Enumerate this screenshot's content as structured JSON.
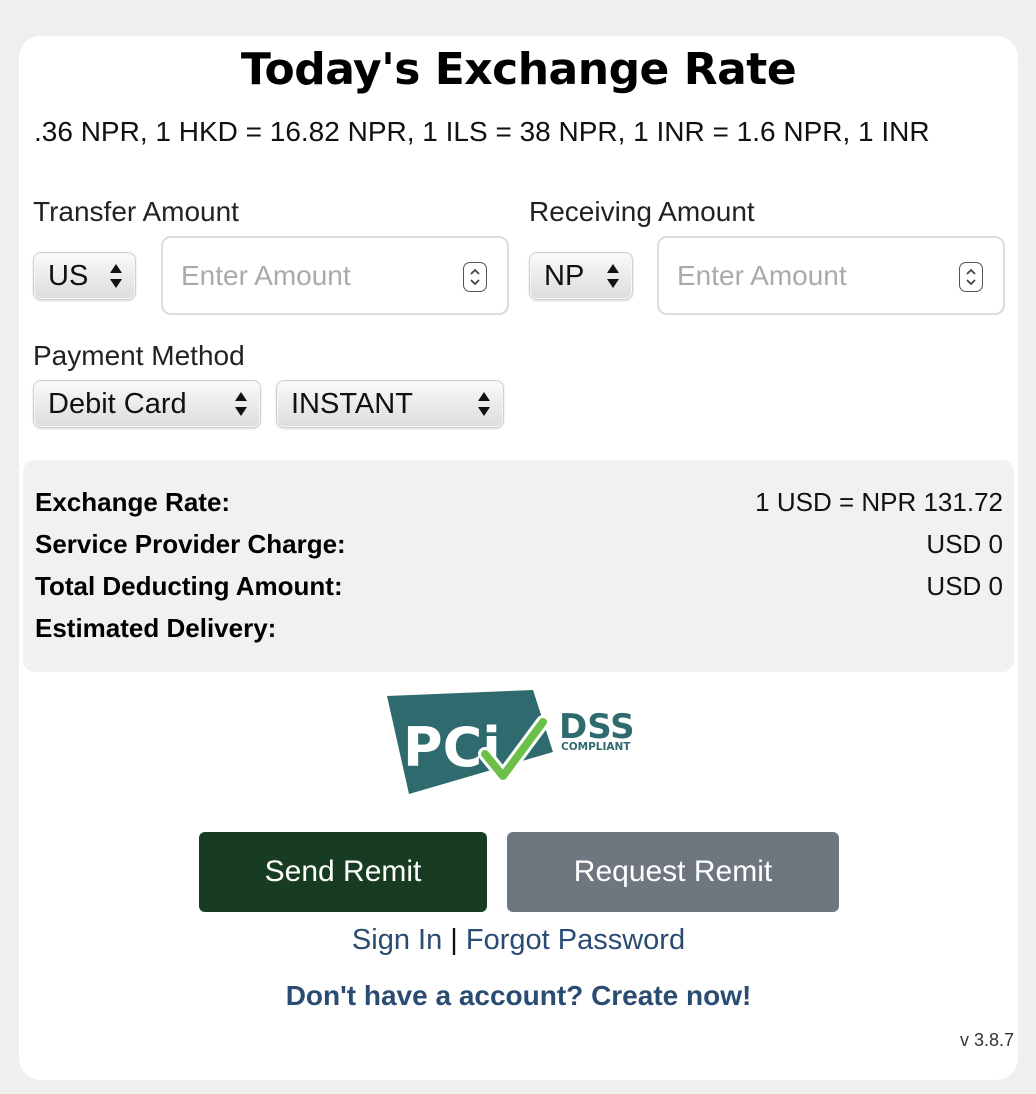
{
  "title": "Today's Exchange Rate",
  "ticker": ".36 NPR,  1 HKD = 16.82 NPR,  1 ILS = 38 NPR,  1 INR = 1.6 NPR,  1 INR",
  "transfer": {
    "label": "Transfer Amount",
    "currency": "US",
    "placeholder": "Enter Amount"
  },
  "receiving": {
    "label": "Receiving Amount",
    "currency": "NP",
    "placeholder": "Enter Amount"
  },
  "payment": {
    "label": "Payment Method",
    "method": "Debit Card",
    "speed": "INSTANT"
  },
  "summary": {
    "exchange_rate_label": "Exchange Rate:",
    "exchange_rate_value": "1 USD = NPR 131.72",
    "service_charge_label": "Service Provider Charge:",
    "service_charge_value": "USD 0",
    "total_label": "Total Deducting Amount:",
    "total_value": "USD 0",
    "delivery_label": "Estimated Delivery:",
    "delivery_value": ""
  },
  "logo": {
    "pci": "PCi",
    "dss": "DSS",
    "compliant": "COMPLIANT"
  },
  "buttons": {
    "send": "Send Remit",
    "request": "Request Remit"
  },
  "links": {
    "sign_in": "Sign In",
    "separator": "|",
    "forgot": "Forgot Password",
    "create": "Don't have a account? Create now!"
  },
  "version": "v 3.8.7",
  "colors": {
    "send_button": "#183c22",
    "request_button": "#6e7680",
    "link": "#2b4c72",
    "pci_teal": "#2f6b6e",
    "check_green": "#6cc04a"
  }
}
